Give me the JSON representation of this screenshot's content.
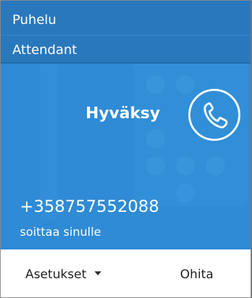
{
  "header": {
    "line1": "Puhelu",
    "line2": "Attendant"
  },
  "accept": {
    "label": "Hyväksy",
    "icon": "phone-icon"
  },
  "caller": {
    "number": "+358757552088",
    "subtitle": "soittaa sinulle"
  },
  "footer": {
    "options_label": "Asetukset",
    "options_icon": "chevron-down-icon",
    "ignore_label": "Ohita"
  },
  "colors": {
    "header_bg": "#2a78bc",
    "panel_bg": "#2f8bd5",
    "footer_bg": "#ffffff"
  }
}
